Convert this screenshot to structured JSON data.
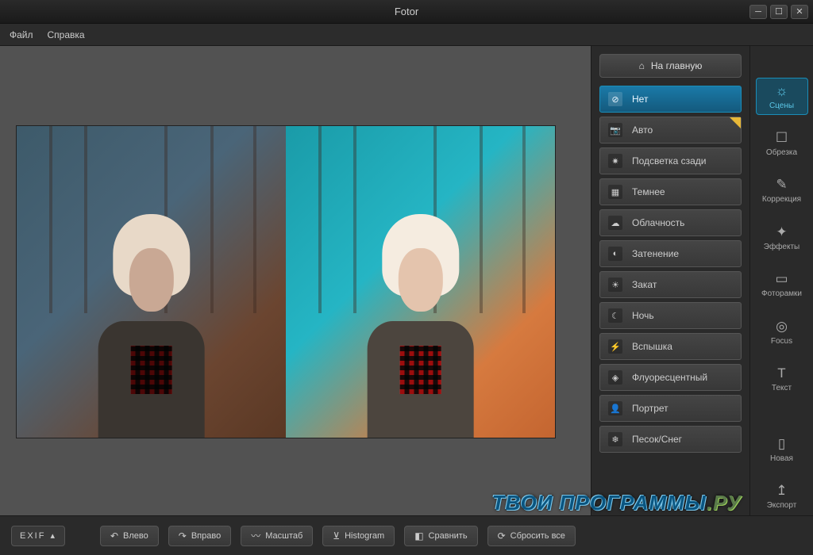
{
  "window": {
    "title": "Fotor"
  },
  "menu": {
    "file": "Файл",
    "help": "Справка"
  },
  "home_button": "На главную",
  "scenes": [
    {
      "label": "Нет",
      "icon": "⊘",
      "active": true
    },
    {
      "label": "Авто",
      "icon": "📷",
      "star": true
    },
    {
      "label": "Подсветка сзади",
      "icon": "✷"
    },
    {
      "label": "Темнее",
      "icon": "▦"
    },
    {
      "label": "Облачность",
      "icon": "☁"
    },
    {
      "label": "Затенение",
      "icon": "◐"
    },
    {
      "label": "Закат",
      "icon": "☀"
    },
    {
      "label": "Ночь",
      "icon": "☾"
    },
    {
      "label": "Вспышка",
      "icon": "⚡"
    },
    {
      "label": "Флуоресцентный",
      "icon": "◈"
    },
    {
      "label": "Портрет",
      "icon": "👤"
    },
    {
      "label": "Песок/Снег",
      "icon": "❄"
    }
  ],
  "tools": {
    "scenes": "Сцены",
    "crop": "Обрезка",
    "correction": "Коррекция",
    "effects": "Эффекты",
    "frames": "Фоторамки",
    "focus": "Focus",
    "text": "Текст",
    "new": "Новая",
    "export": "Экспорт"
  },
  "status": {
    "exif": "EXIF",
    "rotate_left": "Влево",
    "rotate_right": "Вправо",
    "zoom": "Масштаб",
    "histogram": "Histogram",
    "compare": "Сравнить",
    "reset": "Сбросить все"
  },
  "watermark": {
    "text1": "ТВОИ ПРОГРАММЫ",
    "text2": ".РУ"
  }
}
